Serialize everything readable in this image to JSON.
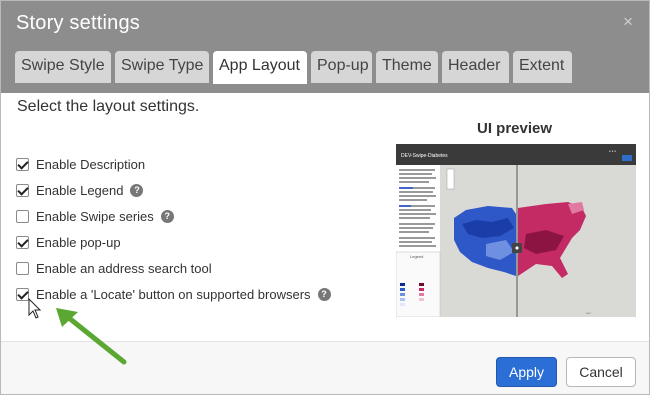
{
  "dialog": {
    "title": "Story settings",
    "close_glyph": "×"
  },
  "tabs": [
    {
      "label": "Swipe Style",
      "active": false
    },
    {
      "label": "Swipe Type",
      "active": false
    },
    {
      "label": "App Layout",
      "active": true
    },
    {
      "label": "Pop-up",
      "active": false
    },
    {
      "label": "Theme",
      "active": false
    },
    {
      "label": "Header",
      "active": false
    },
    {
      "label": "Extent",
      "active": false
    }
  ],
  "content": {
    "instruction": "Select the layout settings.",
    "options": [
      {
        "label": "Enable Description",
        "checked": true,
        "help": false
      },
      {
        "label": "Enable Legend",
        "checked": true,
        "help": true
      },
      {
        "label": "Enable Swipe series",
        "checked": false,
        "help": true
      },
      {
        "label": "Enable pop-up",
        "checked": true,
        "help": false
      },
      {
        "label": "Enable an address search tool",
        "checked": false,
        "help": false
      },
      {
        "label": "Enable a 'Locate' button on supported browsers",
        "checked": true,
        "help": true
      }
    ],
    "help_glyph": "?"
  },
  "preview": {
    "label": "UI preview",
    "app_title": "DEV-Swipe-Diabetes",
    "legend_title": "Legend",
    "colors": {
      "left_map": "#2e57c8",
      "right_map": "#c42a63",
      "header_bar": "#3a3a3a"
    }
  },
  "footer": {
    "apply_label": "Apply",
    "cancel_label": "Cancel"
  },
  "colors": {
    "header_bg": "#8d8d8d",
    "accent_button": "#2b6fd6",
    "annotation_arrow": "#5aa832"
  }
}
